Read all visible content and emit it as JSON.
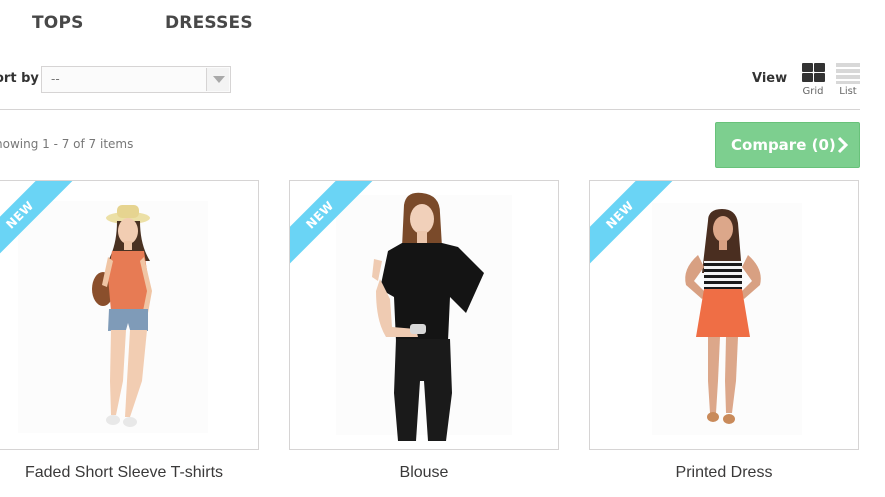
{
  "nav": {
    "items": [
      {
        "label": "TOPS"
      },
      {
        "label": "DRESSES"
      }
    ]
  },
  "toolbar": {
    "sort_label": "ort by",
    "sort_value": "--",
    "view_label": "View",
    "grid_label": "Grid",
    "list_label": "List",
    "showing_text": "howing 1 - 7 of 7 items",
    "compare_label": "Compare (0)"
  },
  "products": [
    {
      "name": "Faded Short Sleeve T-shirts",
      "badge": "NEW"
    },
    {
      "name": "Blouse",
      "badge": "NEW"
    },
    {
      "name": "Printed Dress",
      "badge": "NEW"
    }
  ],
  "colors": {
    "badge": "#6ad4f5",
    "compare_button": "#7dcf8f",
    "border": "#d6d4d4"
  }
}
